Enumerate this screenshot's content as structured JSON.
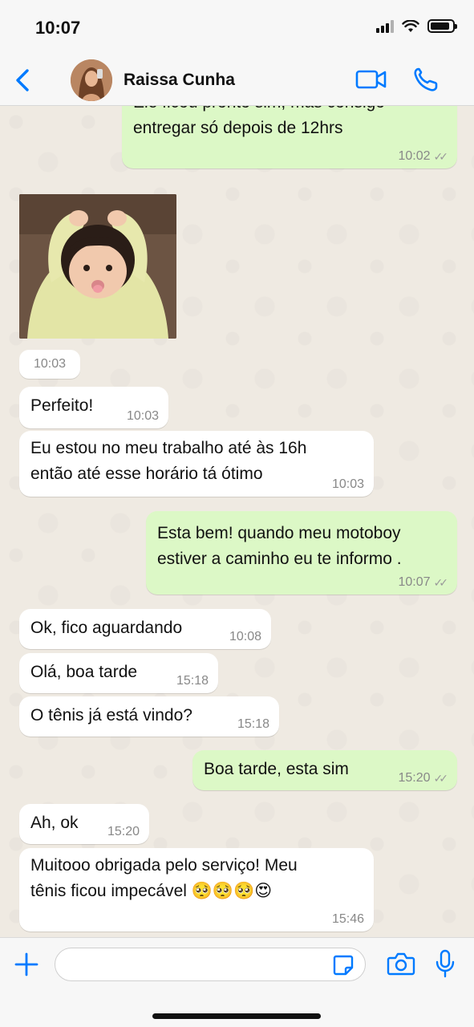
{
  "status_bar": {
    "time": "10:07"
  },
  "header": {
    "contact_name": "Raissa Cunha"
  },
  "colors": {
    "accent": "#007aff",
    "outgoing": "#dcf8c6",
    "incoming": "#ffffff",
    "background": "#efeae2"
  },
  "icons": [
    "chevron-left-icon",
    "video-call-icon",
    "phone-icon",
    "plus-icon",
    "sticker-icon",
    "camera-icon",
    "microphone-icon"
  ],
  "messages": [
    {
      "direction": "out",
      "text_top": "Ele ficou pronto sim, mas consigo",
      "text": "entregar só depois de 12hrs",
      "time": "10:02"
    },
    {
      "direction": "in",
      "type": "sticker",
      "time": "10:03"
    },
    {
      "direction": "in",
      "text": "Perfeito!",
      "time": "10:03"
    },
    {
      "direction": "in",
      "line1": "Eu estou no meu trabalho até às 16h",
      "line2": "então até esse horário tá ótimo",
      "time": "10:03"
    },
    {
      "direction": "out",
      "line1": "Esta bem! quando meu motoboy",
      "line2": "estiver a caminho eu te informo .",
      "time": "10:07"
    },
    {
      "direction": "in",
      "text": "Ok, fico aguardando",
      "time": "10:08"
    },
    {
      "direction": "in",
      "text": "Olá, boa tarde",
      "time": "15:18"
    },
    {
      "direction": "in",
      "text": "O tênis já está vindo?",
      "time": "15:18"
    },
    {
      "direction": "out",
      "text": "Boa tarde, esta sim",
      "time": "15:20"
    },
    {
      "direction": "in",
      "text": "Ah, ok",
      "time": "15:20"
    },
    {
      "direction": "in",
      "line1": "Muitooo obrigada pelo serviço! Meu",
      "line2": "tênis ficou impecável 🥺🥺🥺😍",
      "time": "15:46"
    }
  ],
  "composer": {
    "value": "",
    "placeholder": ""
  }
}
